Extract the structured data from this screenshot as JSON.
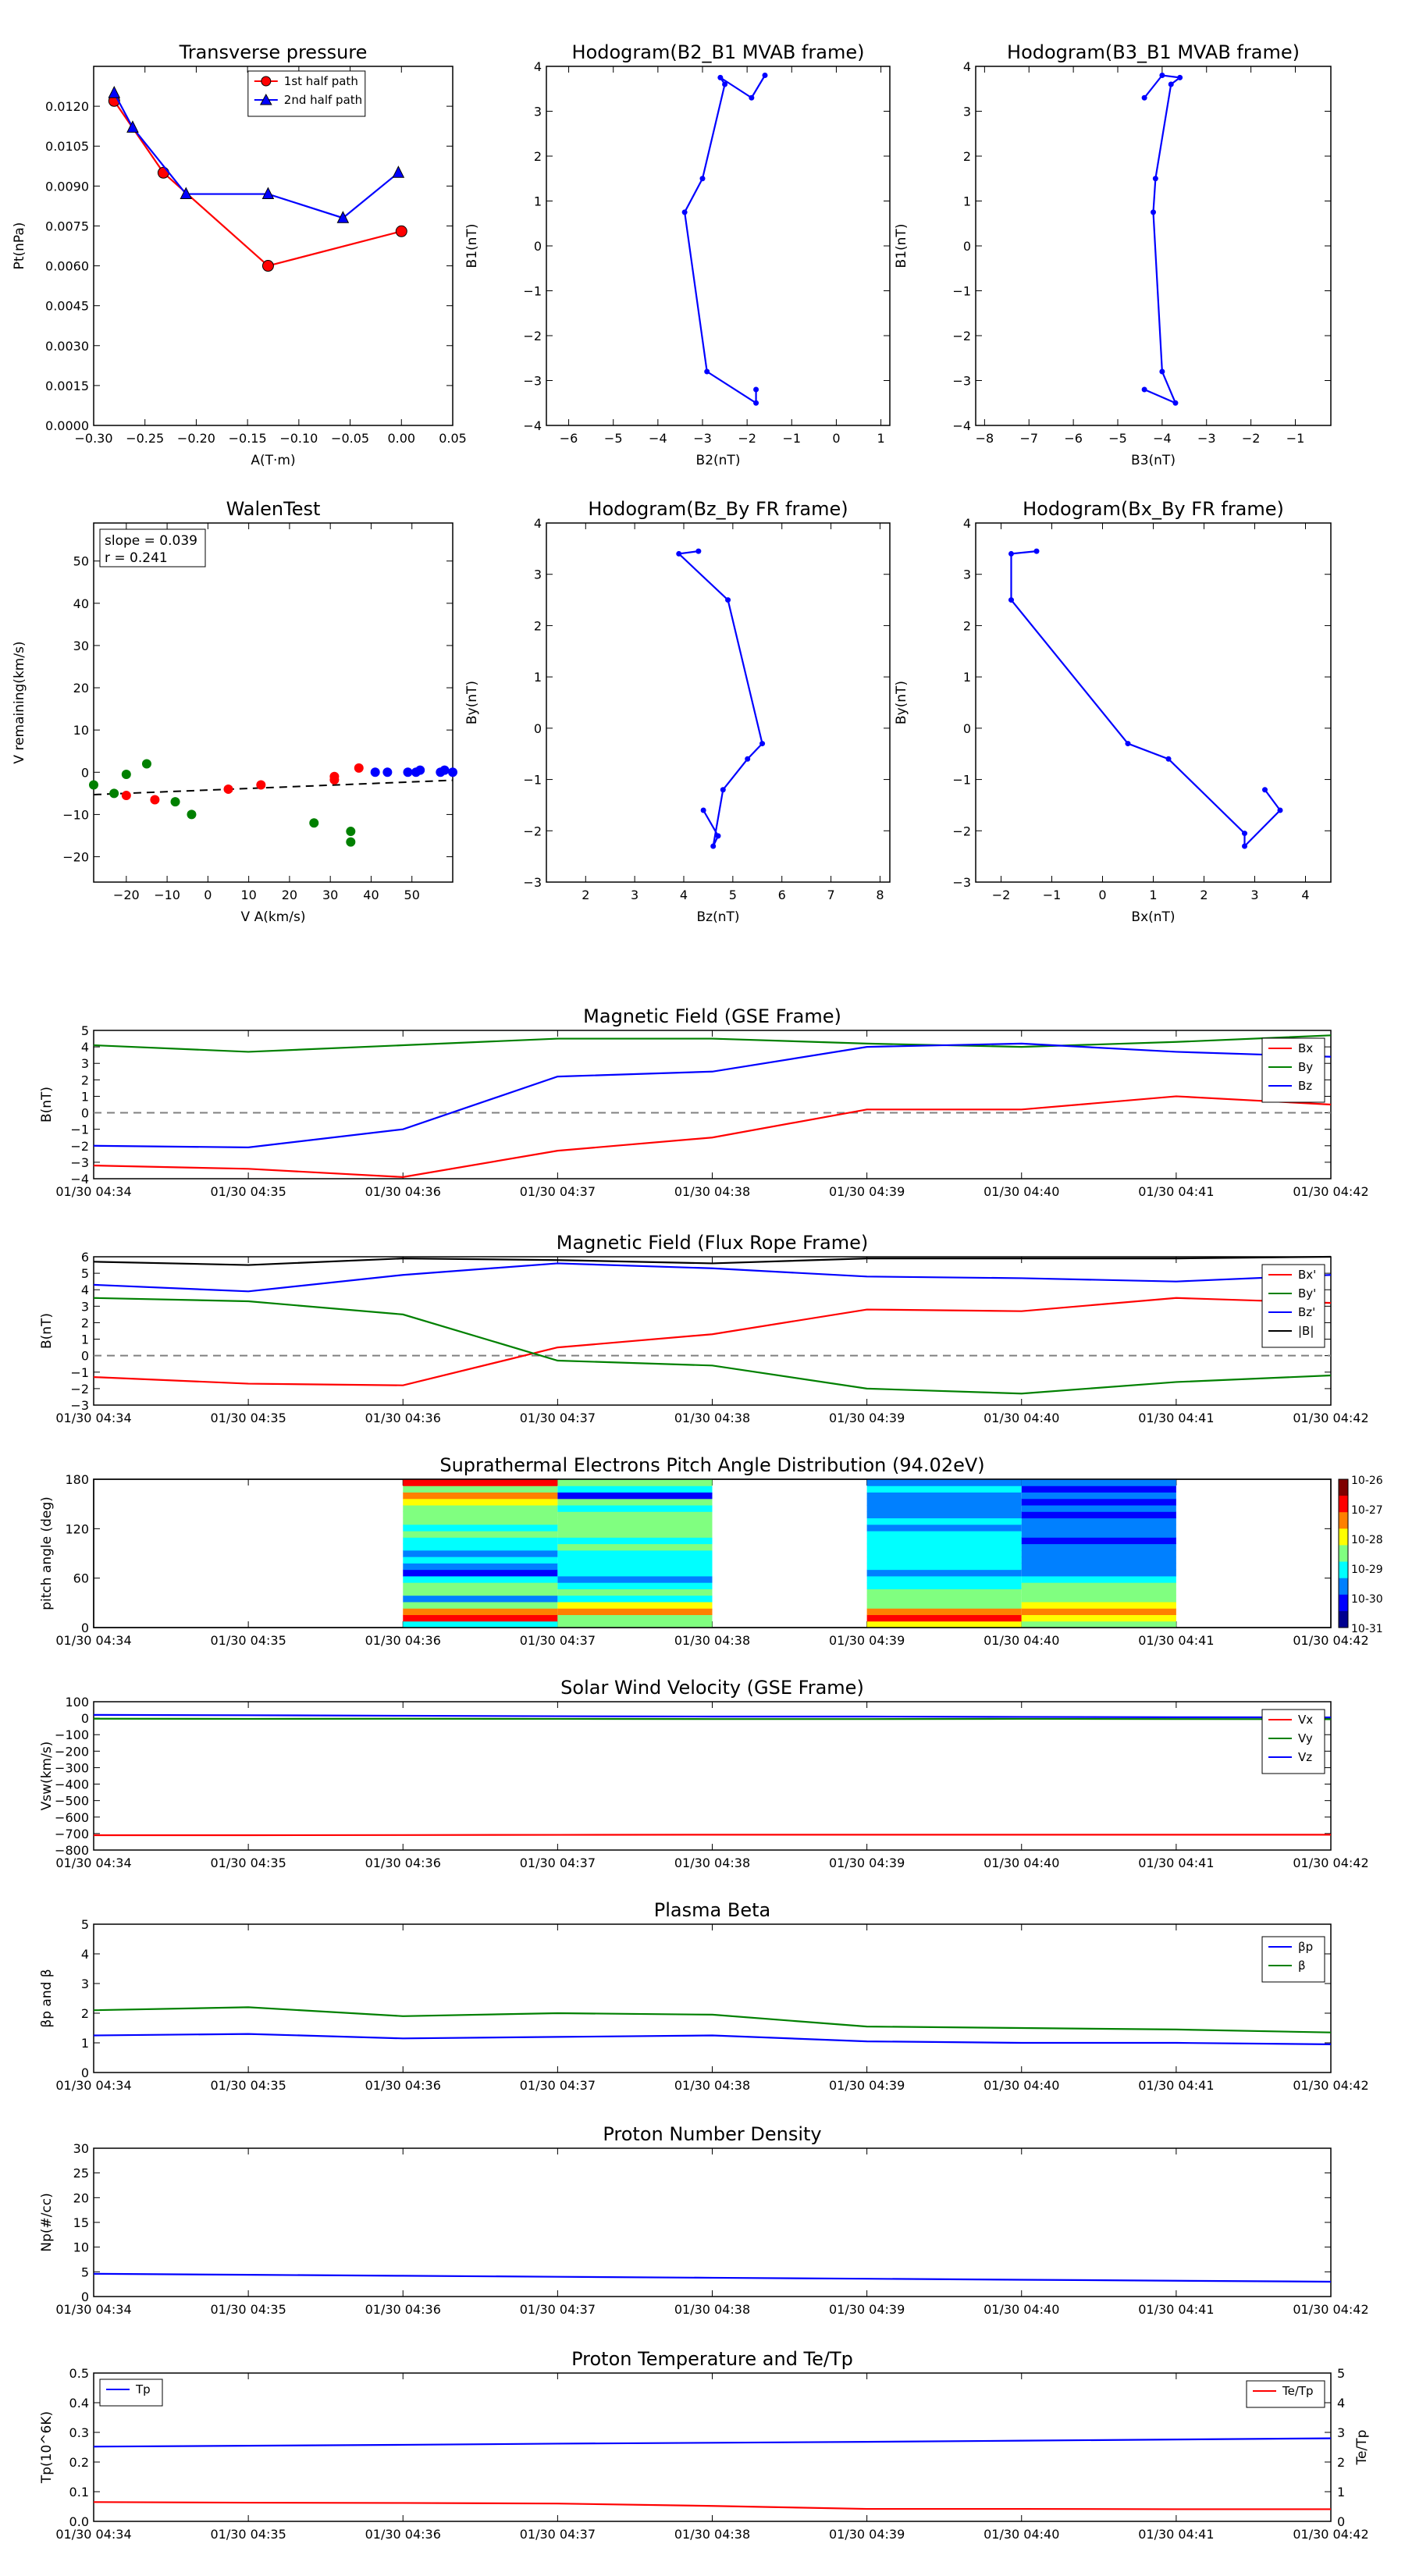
{
  "time_ticks": [
    "01/30 04:34",
    "01/30 04:35",
    "01/30 04:36",
    "01/30 04:37",
    "01/30 04:38",
    "01/30 04:39",
    "01/30 04:40",
    "01/30 04:41",
    "01/30 04:42"
  ],
  "colors": {
    "red": "#ff0000",
    "green": "#008000",
    "blue": "#0000ff",
    "black": "#000000",
    "gray": "#808080"
  },
  "chart_data": [
    {
      "type": "line",
      "title": "Transverse pressure",
      "xlabel": "A(T·m)",
      "ylabel": "Pt(nPa)",
      "xlim": [
        -0.3,
        0.05
      ],
      "ylim": [
        0,
        0.0135
      ],
      "xticks": [
        -0.3,
        -0.25,
        -0.2,
        -0.15,
        -0.1,
        -0.05,
        0.0,
        0.05
      ],
      "xtick_labels": [
        "−0.30",
        "−0.25",
        "−0.20",
        "−0.15",
        "−0.10",
        "−0.05",
        "0.00",
        "0.05"
      ],
      "yticks": [
        0,
        0.0015,
        0.003,
        0.0045,
        0.006,
        0.0075,
        0.009,
        0.0105,
        0.012
      ],
      "ytick_labels": [
        "0.0000",
        "0.0015",
        "0.0030",
        "0.0045",
        "0.0060",
        "0.0075",
        "0.0090",
        "0.0105",
        "0.0120"
      ],
      "legend": "upper center",
      "series": [
        {
          "name": "1st half path",
          "color": "#ff0000",
          "marker": "circle",
          "x": [
            -0.28,
            -0.232,
            -0.13,
            0.0
          ],
          "y": [
            0.0122,
            0.0095,
            0.006,
            0.0073
          ]
        },
        {
          "name": "2nd half path",
          "color": "#0000ff",
          "marker": "triangle",
          "x": [
            -0.28,
            -0.262,
            -0.21,
            -0.13,
            -0.057,
            -0.003
          ],
          "y": [
            0.0125,
            0.0112,
            0.0087,
            0.0087,
            0.0078,
            0.0095
          ]
        }
      ]
    },
    {
      "type": "line",
      "title": "Hodogram(B2_B1 MVAB frame)",
      "xlabel": "B2(nT)",
      "ylabel": "B1(nT)",
      "xlim": [
        -6.5,
        1.2
      ],
      "ylim": [
        -4,
        4
      ],
      "xticks": [
        -6,
        -5,
        -4,
        -3,
        -2,
        -1,
        0,
        1
      ],
      "xtick_labels": [
        "−6",
        "−5",
        "−4",
        "−3",
        "−2",
        "−1",
        "0",
        "1"
      ],
      "yticks": [
        -4,
        -3,
        -2,
        -1,
        0,
        1,
        2,
        3,
        4
      ],
      "ytick_labels": [
        "−4",
        "−3",
        "−2",
        "−1",
        "0",
        "1",
        "2",
        "3",
        "4"
      ],
      "series": [
        {
          "color": "#0000ff",
          "x": [
            -1.8,
            -1.8,
            -2.9,
            -3.4,
            -3.0,
            -2.5,
            -2.6,
            -1.9,
            -1.6
          ],
          "y": [
            -3.2,
            -3.5,
            -2.8,
            0.75,
            1.5,
            3.6,
            3.75,
            3.3,
            3.8
          ]
        }
      ]
    },
    {
      "type": "line",
      "title": "Hodogram(B3_B1 MVAB frame)",
      "xlabel": "B3(nT)",
      "ylabel": "B1(nT)",
      "xlim": [
        -8.2,
        -0.2
      ],
      "ylim": [
        -4,
        4
      ],
      "xticks": [
        -8,
        -7,
        -6,
        -5,
        -4,
        -3,
        -2,
        -1
      ],
      "xtick_labels": [
        "−8",
        "−7",
        "−6",
        "−5",
        "−4",
        "−3",
        "−2",
        "−1"
      ],
      "yticks": [
        -4,
        -3,
        -2,
        -1,
        0,
        1,
        2,
        3,
        4
      ],
      "ytick_labels": [
        "−4",
        "−3",
        "−2",
        "−1",
        "0",
        "1",
        "2",
        "3",
        "4"
      ],
      "series": [
        {
          "color": "#0000ff",
          "x": [
            -4.4,
            -3.7,
            -4.0,
            -4.2,
            -4.15,
            -3.8,
            -3.6,
            -4.0,
            -4.4
          ],
          "y": [
            -3.2,
            -3.5,
            -2.8,
            0.75,
            1.5,
            3.6,
            3.75,
            3.8,
            3.3
          ]
        }
      ]
    },
    {
      "type": "scatter",
      "title": "WalenTest",
      "xlabel": "V A(km/s)",
      "ylabel": "V remaining(km/s)",
      "xlim": [
        -28,
        60
      ],
      "ylim": [
        -26,
        59
      ],
      "xticks": [
        -20,
        -10,
        0,
        10,
        20,
        30,
        40,
        50
      ],
      "xtick_labels": [
        "−20",
        "−10",
        "0",
        "10",
        "20",
        "30",
        "40",
        "50"
      ],
      "yticks": [
        -20,
        -10,
        0,
        10,
        20,
        30,
        40,
        50
      ],
      "ytick_labels": [
        "−20",
        "−10",
        "0",
        "10",
        "20",
        "30",
        "40",
        "50"
      ],
      "annotation": [
        "slope = 0.039",
        "r = 0.241"
      ],
      "fit_line": {
        "x": [
          -28,
          60
        ],
        "y": [
          -5.3,
          -1.9
        ],
        "color": "#000000",
        "style": "dashed"
      },
      "series": [
        {
          "color": "#008000",
          "x": [
            -28,
            -23,
            -20,
            -15,
            -8,
            -4,
            26,
            35,
            35
          ],
          "y": [
            -3,
            -5,
            -0.5,
            2,
            -7,
            -10,
            -12,
            -14,
            -16.5
          ]
        },
        {
          "color": "#ff0000",
          "x": [
            -20,
            -13,
            5,
            13,
            31,
            31,
            37
          ],
          "y": [
            -5.5,
            -6.5,
            -4,
            -3,
            -1,
            -1.8,
            1
          ]
        },
        {
          "color": "#0000ff",
          "x": [
            41,
            44,
            49,
            51,
            52,
            57,
            58,
            60
          ],
          "y": [
            0,
            0,
            0,
            0,
            0.5,
            0,
            0.5,
            0
          ]
        }
      ]
    },
    {
      "type": "line",
      "title": "Hodogram(Bz_By FR frame)",
      "xlabel": "Bz(nT)",
      "ylabel": "By(nT)",
      "xlim": [
        1.2,
        8.2
      ],
      "ylim": [
        -3,
        4
      ],
      "xticks": [
        2,
        3,
        4,
        5,
        6,
        7,
        8
      ],
      "xtick_labels": [
        "2",
        "3",
        "4",
        "5",
        "6",
        "7",
        "8"
      ],
      "yticks": [
        -3,
        -2,
        -1,
        0,
        1,
        2,
        3,
        4
      ],
      "ytick_labels": [
        "−3",
        "−2",
        "−1",
        "0",
        "1",
        "2",
        "3",
        "4"
      ],
      "series": [
        {
          "color": "#0000ff",
          "x": [
            4.3,
            3.9,
            4.9,
            5.6,
            5.3,
            4.8,
            4.6,
            4.7,
            4.4
          ],
          "y": [
            3.45,
            3.4,
            2.5,
            -0.3,
            -0.6,
            -1.2,
            -2.3,
            -2.1,
            -1.6
          ]
        }
      ]
    },
    {
      "type": "line",
      "title": "Hodogram(Bx_By FR frame)",
      "xlabel": "Bx(nT)",
      "ylabel": "By(nT)",
      "xlim": [
        -2.5,
        4.5
      ],
      "ylim": [
        -3,
        4
      ],
      "xticks": [
        -2,
        -1,
        0,
        1,
        2,
        3,
        4
      ],
      "xtick_labels": [
        "−2",
        "−1",
        "0",
        "1",
        "2",
        "3",
        "4"
      ],
      "yticks": [
        -3,
        -2,
        -1,
        0,
        1,
        2,
        3,
        4
      ],
      "ytick_labels": [
        "−3",
        "−2",
        "−1",
        "0",
        "1",
        "2",
        "3",
        "4"
      ],
      "series": [
        {
          "color": "#0000ff",
          "x": [
            -1.3,
            -1.8,
            -1.8,
            0.5,
            1.3,
            2.8,
            2.8,
            3.5,
            3.2
          ],
          "y": [
            3.45,
            3.4,
            2.5,
            -0.3,
            -0.6,
            -2.05,
            -2.3,
            -1.6,
            -1.2
          ]
        }
      ]
    },
    {
      "type": "line",
      "title": "Magnetic Field (GSE Frame)",
      "ylabel": "B(nT)",
      "xlim": [
        0,
        8
      ],
      "ylim": [
        -4,
        5
      ],
      "yticks": [
        -4,
        -3,
        -2,
        -1,
        0,
        1,
        2,
        3,
        4,
        5
      ],
      "ytick_labels": [
        "−4",
        "−3",
        "−2",
        "−1",
        "0",
        "1",
        "2",
        "3",
        "4",
        "5"
      ],
      "zero_line": true,
      "legend": "right",
      "x": [
        0,
        1,
        2,
        3,
        4,
        5,
        6,
        7,
        8
      ],
      "series": [
        {
          "name": "Bx",
          "color": "#ff0000",
          "values": [
            -3.2,
            -3.4,
            -3.9,
            -2.3,
            -1.5,
            0.2,
            0.2,
            1.0,
            0.5
          ]
        },
        {
          "name": "By",
          "color": "#008000",
          "values": [
            4.1,
            3.7,
            4.1,
            4.5,
            4.5,
            4.2,
            4.0,
            4.3,
            4.7
          ]
        },
        {
          "name": "Bz",
          "color": "#0000ff",
          "values": [
            -2.0,
            -2.1,
            -1.0,
            2.2,
            2.5,
            4.0,
            4.2,
            3.7,
            3.4
          ]
        }
      ]
    },
    {
      "type": "line",
      "title": "Magnetic Field (Flux Rope Frame)",
      "ylabel": "B(nT)",
      "xlim": [
        0,
        8
      ],
      "ylim": [
        -3,
        6
      ],
      "yticks": [
        -3,
        -2,
        -1,
        0,
        1,
        2,
        3,
        4,
        5,
        6
      ],
      "ytick_labels": [
        "−3",
        "−2",
        "−1",
        "0",
        "1",
        "2",
        "3",
        "4",
        "5",
        "6"
      ],
      "zero_line": true,
      "legend": "right",
      "x": [
        0,
        1,
        2,
        3,
        4,
        5,
        6,
        7,
        8
      ],
      "series": [
        {
          "name": "Bx'",
          "color": "#ff0000",
          "values": [
            -1.3,
            -1.7,
            -1.8,
            0.5,
            1.3,
            2.8,
            2.7,
            3.5,
            3.2
          ]
        },
        {
          "name": "By'",
          "color": "#008000",
          "values": [
            3.5,
            3.3,
            2.5,
            -0.3,
            -0.6,
            -2.0,
            -2.3,
            -1.6,
            -1.2
          ]
        },
        {
          "name": "Bz'",
          "color": "#0000ff",
          "values": [
            4.3,
            3.9,
            4.9,
            5.6,
            5.3,
            4.8,
            4.7,
            4.5,
            4.9
          ]
        },
        {
          "name": "|B|",
          "color": "#000000",
          "values": [
            5.7,
            5.5,
            5.9,
            5.8,
            5.6,
            5.9,
            5.9,
            5.9,
            6.0
          ]
        }
      ]
    },
    {
      "type": "heatmap",
      "title": "Suprathermal Electrons Pitch Angle Distribution (94.02eV)",
      "ylabel": "pitch angle (deg)",
      "xlim": [
        0,
        8
      ],
      "ylim": [
        0,
        180
      ],
      "yticks": [
        0,
        60,
        120,
        180
      ],
      "ytick_labels": [
        "0",
        "60",
        "120",
        "180"
      ],
      "colorbar_ticks": [
        "10-26",
        "10-27",
        "10-28",
        "10-29",
        "10-30",
        "10-31"
      ],
      "columns": [
        {
          "x0": 2,
          "x1": 3,
          "rows": [
            0.4,
            0.85,
            0.8,
            0.55,
            0.3,
            0.5,
            0.45,
            0.35,
            0.15,
            0.25,
            0.35,
            0.3,
            0.35,
            0.4,
            0.45,
            0.4,
            0.55,
            0.45,
            0.55,
            0.65,
            0.7,
            0.55,
            0.85
          ]
        },
        {
          "x0": 3,
          "x1": 4,
          "rows": [
            0.5,
            0.55,
            0.7,
            0.6,
            0.4,
            0.45,
            0.35,
            0.3,
            0.35,
            0.4,
            0.4,
            0.4,
            0.45,
            0.4,
            0.5,
            0.45,
            0.55,
            0.45,
            0.35,
            0.45,
            0.15,
            0.35,
            0.45
          ]
        },
        {
          "x0": 5,
          "x1": 6,
          "rows": [
            0.6,
            0.85,
            0.75,
            0.55,
            0.5,
            0.45,
            0.4,
            0.35,
            0.3,
            0.35,
            0.4,
            0.35,
            0.4,
            0.35,
            0.4,
            0.3,
            0.35,
            0.25,
            0.3,
            0.25,
            0.25,
            0.35,
            0.25
          ]
        },
        {
          "x0": 6,
          "x1": 7,
          "rows": [
            0.55,
            0.65,
            0.7,
            0.6,
            0.5,
            0.5,
            0.45,
            0.4,
            0.3,
            0.25,
            0.2,
            0.3,
            0.2,
            0.15,
            0.25,
            0.2,
            0.25,
            0.1,
            0.2,
            0.1,
            0.2,
            0.15,
            0.3
          ]
        }
      ]
    },
    {
      "type": "line",
      "title": "Solar Wind Velocity (GSE Frame)",
      "ylabel": "Vsw(km/s)",
      "xlim": [
        0,
        8
      ],
      "ylim": [
        -800,
        100
      ],
      "yticks": [
        -800,
        -700,
        -600,
        -500,
        -400,
        -300,
        -200,
        -100,
        0,
        100
      ],
      "ytick_labels": [
        "−800",
        "−700",
        "−600",
        "−500",
        "−400",
        "−300",
        "−200",
        "−100",
        "0",
        "100"
      ],
      "legend": "right",
      "x": [
        0,
        1,
        2,
        3,
        4,
        5,
        6,
        7,
        8
      ],
      "series": [
        {
          "name": "Vx",
          "color": "#ff0000",
          "values": [
            -710,
            -710,
            -709,
            -708,
            -707,
            -707,
            -707,
            -707,
            -707
          ]
        },
        {
          "name": "Vy",
          "color": "#008000",
          "values": [
            -3,
            -4,
            -3,
            -4,
            -5,
            -5,
            -4,
            -5,
            -6
          ]
        },
        {
          "name": "Vz",
          "color": "#0000ff",
          "values": [
            20,
            18,
            15,
            12,
            10,
            10,
            8,
            6,
            5
          ]
        }
      ]
    },
    {
      "type": "line",
      "title": "Plasma Beta",
      "ylabel": "βp and β",
      "xlim": [
        0,
        8
      ],
      "ylim": [
        0,
        5
      ],
      "yticks": [
        0,
        1,
        2,
        3,
        4,
        5
      ],
      "ytick_labels": [
        "0",
        "1",
        "2",
        "3",
        "4",
        "5"
      ],
      "legend": "upper right",
      "x": [
        0,
        1,
        2,
        3,
        4,
        5,
        6,
        7,
        8
      ],
      "series": [
        {
          "name": "βp",
          "color": "#0000ff",
          "values": [
            1.25,
            1.3,
            1.15,
            1.2,
            1.25,
            1.05,
            1.0,
            1.0,
            0.95
          ]
        },
        {
          "name": "β",
          "color": "#008000",
          "values": [
            2.1,
            2.2,
            1.9,
            2.0,
            1.95,
            1.55,
            1.5,
            1.45,
            1.35
          ]
        }
      ]
    },
    {
      "type": "line",
      "title": "Proton Number Density",
      "ylabel": "Np(#/cc)",
      "xlim": [
        0,
        8
      ],
      "ylim": [
        0,
        30
      ],
      "yticks": [
        0,
        5,
        10,
        15,
        20,
        25,
        30
      ],
      "ytick_labels": [
        "0",
        "5",
        "10",
        "15",
        "20",
        "25",
        "30"
      ],
      "x": [
        0,
        1,
        2,
        3,
        4,
        5,
        6,
        7,
        8
      ],
      "series": [
        {
          "color": "#0000ff",
          "values": [
            4.6,
            4.4,
            4.2,
            4.0,
            3.8,
            3.6,
            3.4,
            3.2,
            3.0
          ]
        }
      ]
    },
    {
      "type": "line",
      "title": "Proton Temperature and Te/Tp",
      "ylabel": "Tp(10^6K)",
      "ylabel_right": "Te/Tp",
      "xlim": [
        0,
        8
      ],
      "ylim": [
        0,
        0.5
      ],
      "ylim_right": [
        0,
        5
      ],
      "yticks": [
        0,
        0.1,
        0.2,
        0.3,
        0.4,
        0.5
      ],
      "ytick_labels": [
        "0.0",
        "0.1",
        "0.2",
        "0.3",
        "0.4",
        "0.5"
      ],
      "yticks_right": [
        0,
        1,
        2,
        3,
        4,
        5
      ],
      "ytick_labels_right": [
        "0",
        "1",
        "2",
        "3",
        "4",
        "5"
      ],
      "x": [
        0,
        1,
        2,
        3,
        4,
        5,
        6,
        7,
        8
      ],
      "series": [
        {
          "name": "Tp",
          "color": "#0000ff",
          "axis": "left",
          "values": [
            0.252,
            0.255,
            0.258,
            0.262,
            0.265,
            0.268,
            0.272,
            0.276,
            0.28
          ]
        },
        {
          "name": "Te/Tp",
          "color": "#ff0000",
          "axis": "right",
          "values": [
            0.65,
            0.63,
            0.62,
            0.6,
            0.52,
            0.42,
            0.42,
            0.41,
            0.41
          ]
        }
      ]
    }
  ]
}
